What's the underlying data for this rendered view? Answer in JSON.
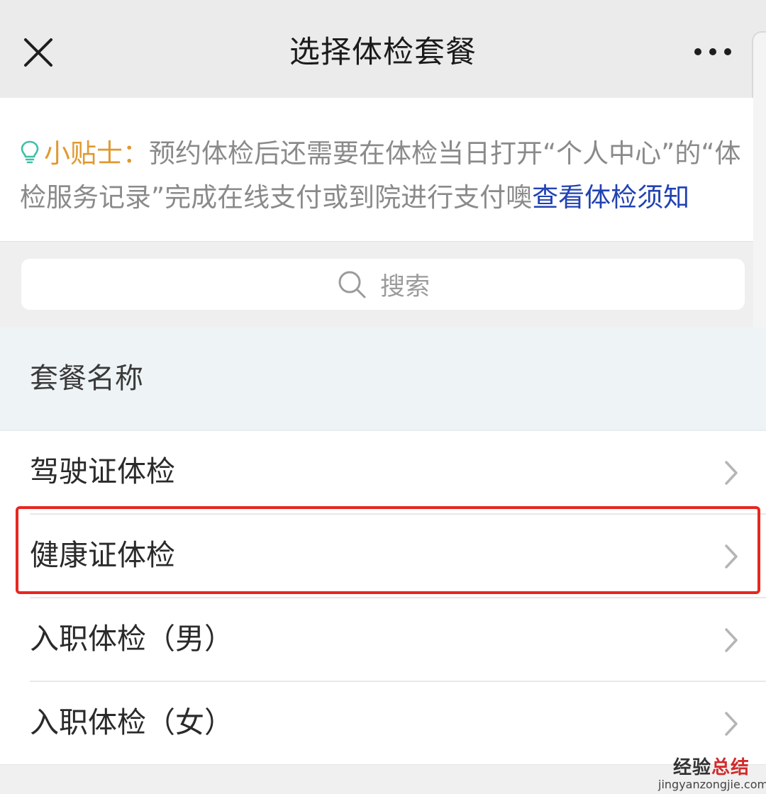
{
  "navbar": {
    "title": "选择体检套餐",
    "close_icon": "close-icon",
    "more_icon": "more-horizontal-icon"
  },
  "tips": {
    "icon": "lightbulb-icon",
    "label": "小贴士：",
    "body": "预约体检后还需要在体检当日打开“个人中心”的“体检服务记录”完成在线支付或到院进行支付噢",
    "link": "查看体检须知"
  },
  "search": {
    "icon": "search-icon",
    "placeholder": "搜索"
  },
  "list": {
    "header": "套餐名称",
    "items": [
      {
        "label": "驾驶证体检"
      },
      {
        "label": "健康证体检"
      },
      {
        "label": "入职体检（男）"
      },
      {
        "label": "入职体检（女）"
      }
    ]
  },
  "watermark": {
    "main_prefix": "经验",
    "main_accent": "总结",
    "sub": "jingyanzongjie.com"
  },
  "colors": {
    "tip_label": "#e0992f",
    "tip_link": "#2142b2",
    "highlight": "#e8271f",
    "bulb": "#3fbfa6"
  }
}
